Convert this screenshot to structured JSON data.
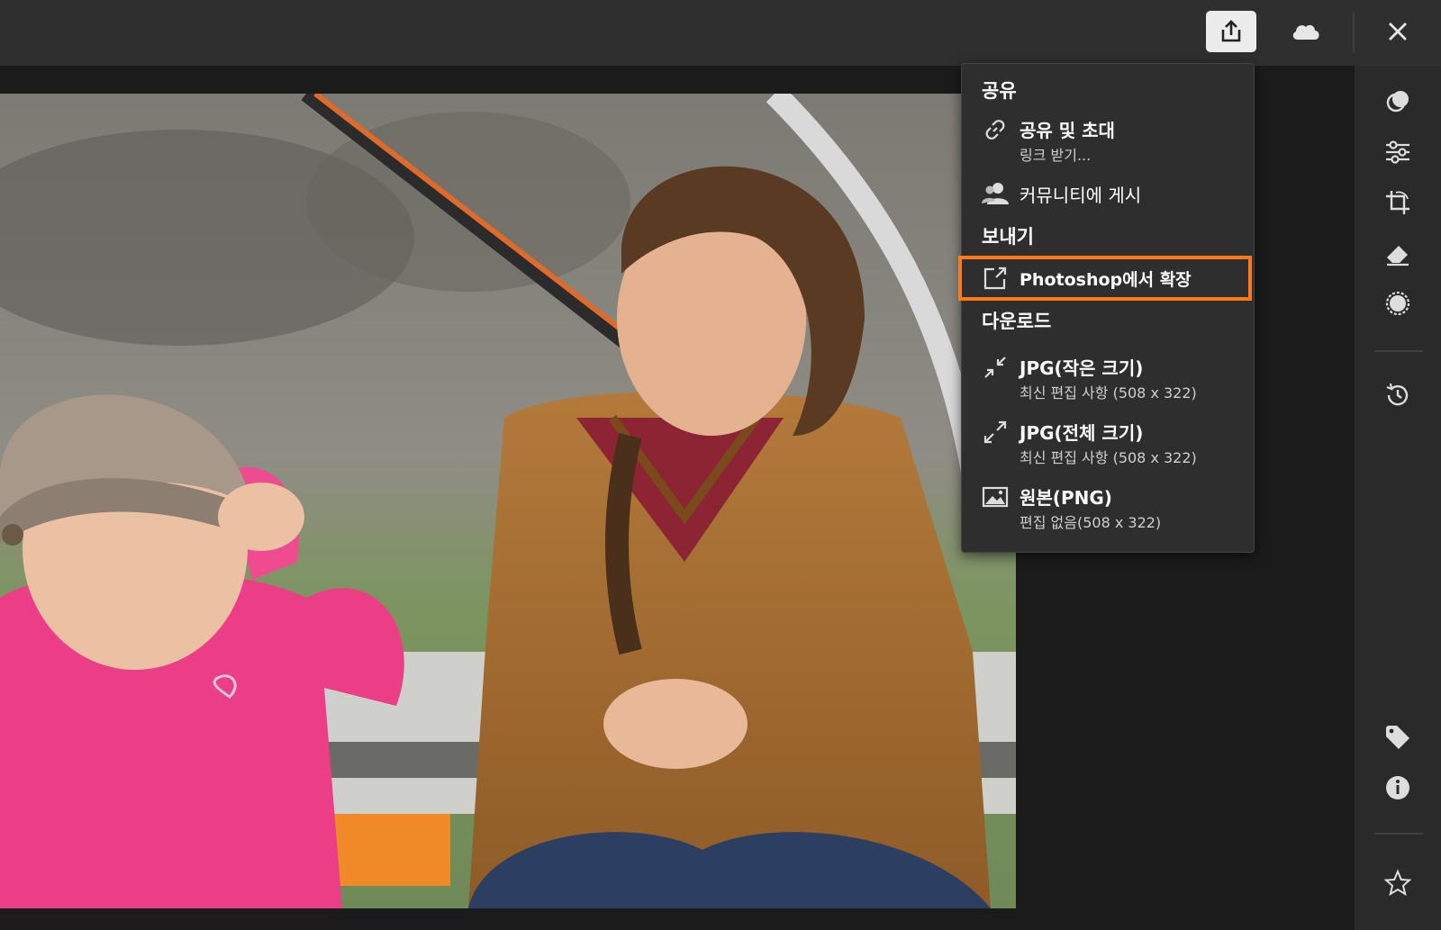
{
  "toolbar": {
    "share_icon": "share-export-icon",
    "cloud_icon": "cloud-icon",
    "close_icon": "close-icon"
  },
  "share_menu": {
    "section_share": "공유",
    "share_invite": {
      "title": "공유 및 초대",
      "subtitle": "링크 받기...",
      "icon": "link-icon"
    },
    "post_community": {
      "title": "커뮤니티에 게시",
      "icon": "community-icon"
    },
    "section_send": "보내기",
    "photoshop": {
      "title": "Photoshop에서 확장",
      "icon": "open-external-icon",
      "highlight_color": "#ff7a1a"
    },
    "section_download": "다운로드",
    "jpg_small": {
      "title": "JPG(작은 크기)",
      "subtitle": "최신 편집 사항 (508 x 322)",
      "icon": "shrink-icon"
    },
    "jpg_full": {
      "title": "JPG(전체 크기)",
      "subtitle": "최신 편집 사항 (508 x 322)",
      "icon": "expand-icon"
    },
    "original_png": {
      "title": "원본(PNG)",
      "subtitle": "편집 없음(508 x 322)",
      "icon": "image-icon"
    }
  },
  "right_panel": {
    "icons": [
      "overlay-icon",
      "adjust-sliders-icon",
      "crop-rotate-icon",
      "eraser-icon",
      "selection-circle-icon",
      "history-icon",
      "tag-icon",
      "info-icon",
      "star-icon"
    ]
  },
  "colors": {
    "topbar": "#2f2f2f",
    "panel": "#2a2a2a",
    "menu": "#2e2e2e",
    "accent": "#ff7a1a"
  }
}
